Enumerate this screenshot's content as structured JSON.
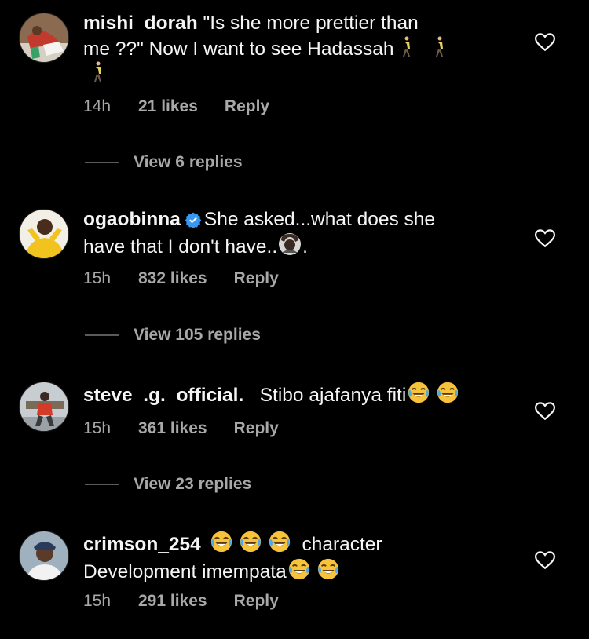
{
  "comments": [
    {
      "username": "mishi_dorah",
      "text_line1": "\"Is she more prettier than",
      "text_line2": "me ??\" Now I want to see Hadassah",
      "time": "14h",
      "likes": "21 likes",
      "reply": "Reply",
      "view_replies": "View 6 replies",
      "verified": false
    },
    {
      "username": "ogaobinna",
      "text_line1": "She asked...what does she",
      "text_line2": "have that I don't have..",
      "text_line2_end": ".",
      "time": "15h",
      "likes": "832 likes",
      "reply": "Reply",
      "view_replies": "View 105 replies",
      "verified": true
    },
    {
      "username": "steve_.g._official._",
      "text_line1": "Stibo ajafanya fiti",
      "time": "15h",
      "likes": "361 likes",
      "reply": "Reply",
      "view_replies": "View 23 replies",
      "verified": false
    },
    {
      "username": "crimson_254",
      "text_line1": "character",
      "text_line2": "Development imempata",
      "time": "15h",
      "likes": "291 likes",
      "reply": "Reply",
      "verified": false
    }
  ],
  "icons": {
    "like": "heart-outline-icon",
    "verified": "verified-badge-icon",
    "emoji_walking": "person-walking-emoji",
    "emoji_laugh": "face-with-tears-of-joy-emoji",
    "emoji_facepalm": "person-gesturing-emoji"
  },
  "colors": {
    "background": "#000000",
    "text": "#f5f5f5",
    "meta": "#a8a8a8",
    "verified": "#3897f0"
  }
}
